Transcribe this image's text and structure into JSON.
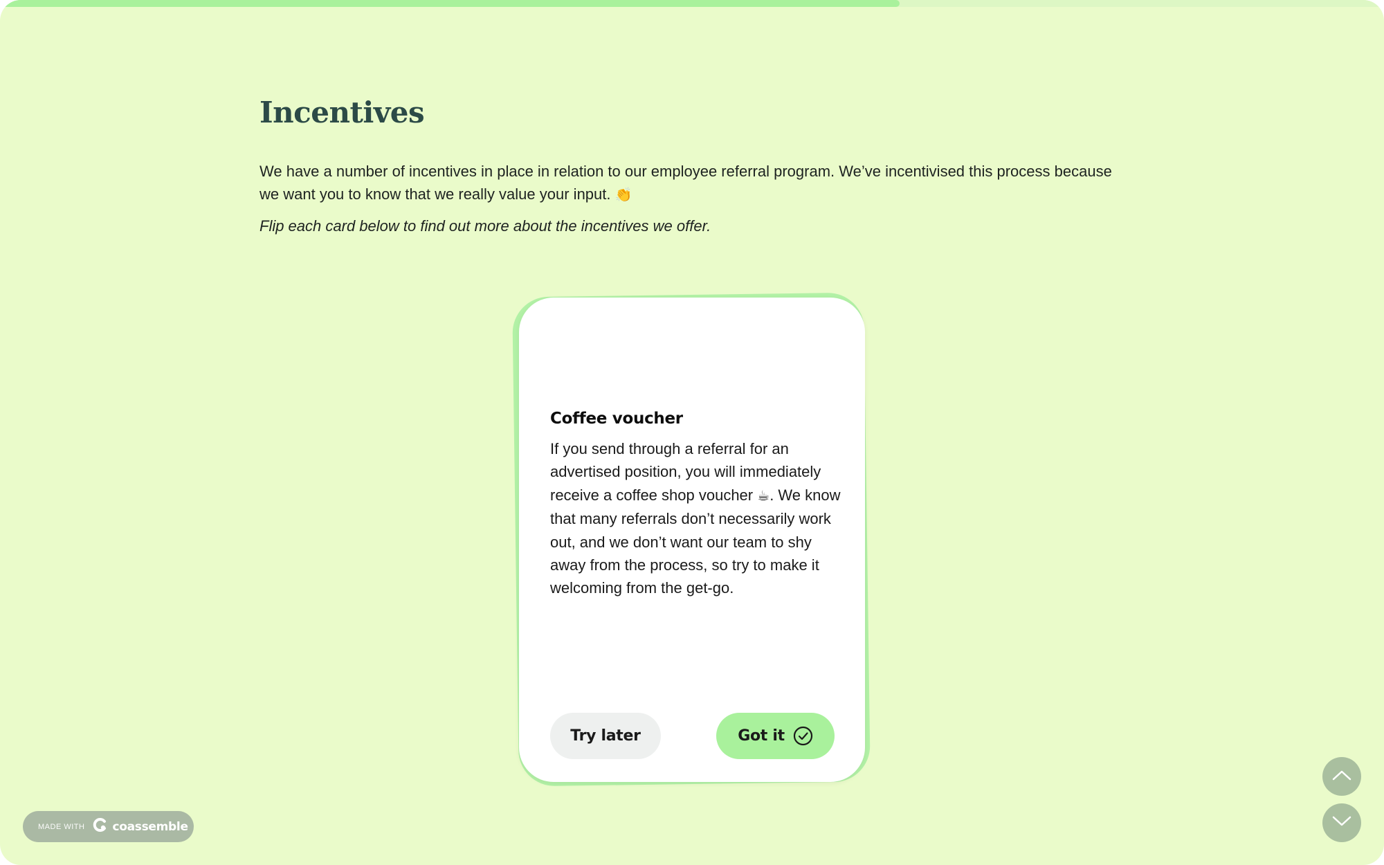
{
  "progress": {
    "fraction": 0.65
  },
  "page": {
    "title": "Incentives",
    "intro": "We have a number of incentives in place in relation to our employee referral program. We’ve incentivised this process because we want you to know that we really value your input.",
    "intro_emoji": "👏",
    "hint": "Flip each card below to find out more about the incentives we offer."
  },
  "card": {
    "title": "Coffee voucher",
    "body_part1": "If you send through a referral for an advertised position, you will immediately receive a coffee shop voucher",
    "body_emoji": "☕",
    "body_part2": ". We know that many referrals don’t necessarily work out, and we don’t want our team to shy away from the process, so try to make it welcoming from the get-go.",
    "try_later_label": "Try later",
    "got_it_label": "Got it"
  },
  "badge": {
    "made_with": "MADE WITH",
    "brand": "coassemble"
  },
  "colors": {
    "background": "#eafbca",
    "accent": "#a9f19c",
    "title": "#2c4a47",
    "nav": "#a9bf9f"
  },
  "icons": {
    "got_it": "check-circle-icon",
    "nav_up": "chevron-up-icon",
    "nav_down": "chevron-down-icon",
    "brand": "coassemble-logo-icon"
  }
}
